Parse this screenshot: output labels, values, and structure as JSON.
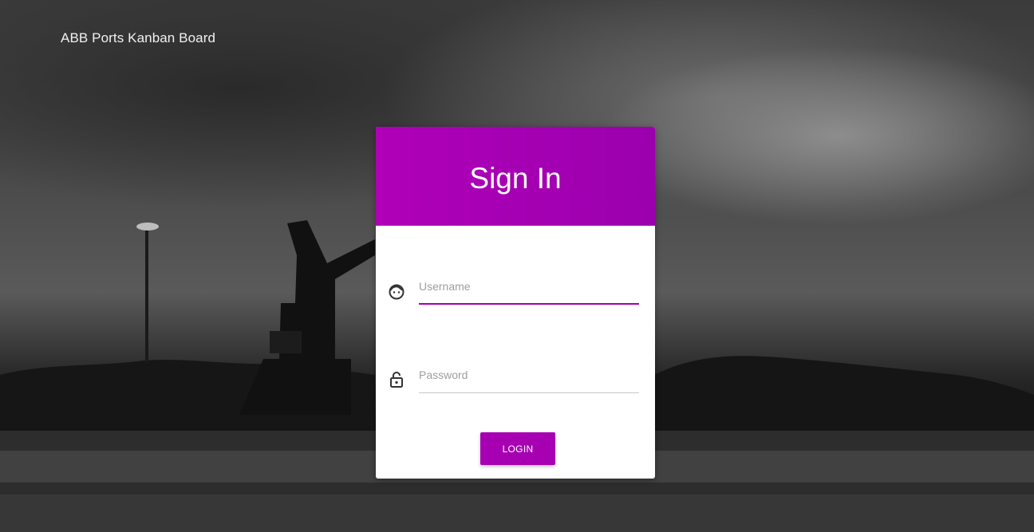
{
  "app": {
    "title": "ABB Ports Kanban Board"
  },
  "login_card": {
    "title": "Sign In",
    "username": {
      "value": "",
      "placeholder": "Username",
      "icon": "face-icon"
    },
    "password": {
      "value": "",
      "placeholder": "Password",
      "icon": "lock-icon"
    },
    "login_label": "LOGIN"
  },
  "colors": {
    "accent": "#a700b3",
    "header_gradient_start": "#b000b8",
    "header_gradient_end": "#9b00ae"
  }
}
